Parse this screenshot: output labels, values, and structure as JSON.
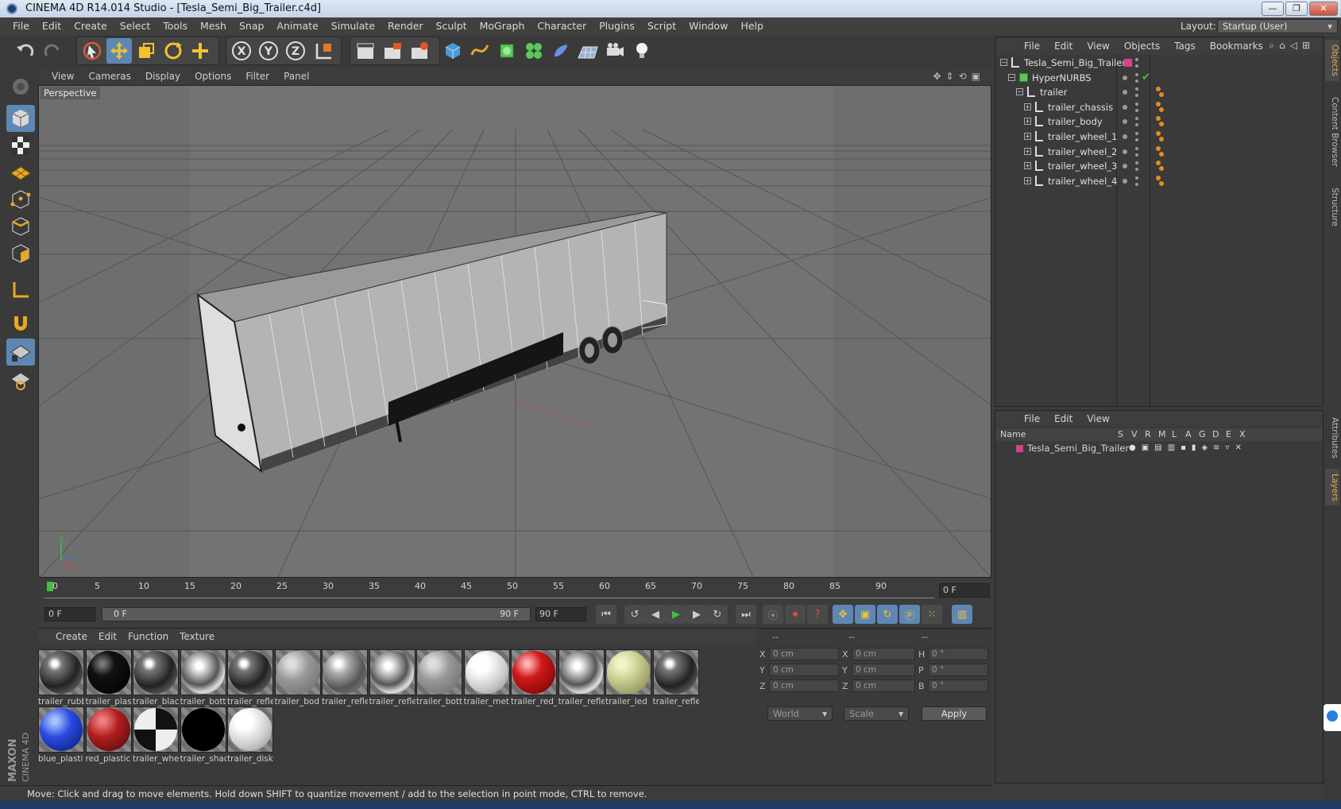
{
  "window": {
    "title": "CINEMA 4D R14.014 Studio - [Tesla_Semi_Big_Trailer.c4d]",
    "minimize": "—",
    "maximize": "❐",
    "close": "✕"
  },
  "menubar": {
    "items": [
      "File",
      "Edit",
      "Create",
      "Select",
      "Tools",
      "Mesh",
      "Snap",
      "Animate",
      "Simulate",
      "Render",
      "Sculpt",
      "MoGraph",
      "Character",
      "Plugins",
      "Script",
      "Window",
      "Help"
    ]
  },
  "layout": {
    "label": "Layout:",
    "value": "Startup (User)"
  },
  "viewport": {
    "menu": [
      "View",
      "Cameras",
      "Display",
      "Options",
      "Filter",
      "Panel"
    ],
    "label": "Perspective"
  },
  "timeline": {
    "ticks": [
      "0",
      "5",
      "10",
      "15",
      "20",
      "25",
      "30",
      "35",
      "40",
      "45",
      "50",
      "55",
      "60",
      "65",
      "70",
      "75",
      "80",
      "85",
      "90"
    ],
    "current_frame": "0 F"
  },
  "transport": {
    "start_field": "0 F",
    "range_start": "0 F",
    "range_end": "90 F",
    "end_field": "90 F"
  },
  "materials": {
    "menu": [
      "Create",
      "Edit",
      "Function",
      "Texture"
    ],
    "items": [
      {
        "name": "trailer_rubb",
        "style": "dark-metal"
      },
      {
        "name": "trailer_plas",
        "style": "black"
      },
      {
        "name": "trailer_blac",
        "style": "dark-metal"
      },
      {
        "name": "trailer_bott",
        "style": "chrome"
      },
      {
        "name": "trailer_refle",
        "style": "dark-metal"
      },
      {
        "name": "trailer_bod",
        "style": "grey"
      },
      {
        "name": "trailer_refle",
        "style": "grey-metal"
      },
      {
        "name": "trailer_refle",
        "style": "chrome"
      },
      {
        "name": "trailer_bott",
        "style": "grey"
      },
      {
        "name": "trailer_met",
        "style": "white"
      },
      {
        "name": "trailer_red_",
        "style": "red-glass"
      },
      {
        "name": "trailer_refle",
        "style": "chrome"
      },
      {
        "name": "trailer_led",
        "style": "olive"
      },
      {
        "name": "trailer_refle",
        "style": "dark-metal"
      },
      {
        "name": "blue_plasti",
        "style": "blue"
      },
      {
        "name": "red_plastic",
        "style": "red"
      },
      {
        "name": "trailer_whe",
        "style": "pattern"
      },
      {
        "name": "trailer_shac",
        "style": "pure-black"
      },
      {
        "name": "trailer_disk",
        "style": "white"
      }
    ]
  },
  "coords": {
    "header": [
      "--",
      "--",
      "--"
    ],
    "rows": [
      {
        "a": "X",
        "av": "0 cm",
        "b": "X",
        "bv": "0 cm",
        "c": "H",
        "cv": "0 °"
      },
      {
        "a": "Y",
        "av": "0 cm",
        "b": "Y",
        "bv": "0 cm",
        "c": "P",
        "cv": "0 °"
      },
      {
        "a": "Z",
        "av": "0 cm",
        "b": "Z",
        "bv": "0 cm",
        "c": "B",
        "cv": "0 °"
      }
    ],
    "mode1": "World",
    "mode2": "Scale",
    "apply": "Apply"
  },
  "objects": {
    "menu": [
      "File",
      "Edit",
      "View",
      "Objects",
      "Tags",
      "Bookmarks"
    ],
    "tree": [
      {
        "name": "Tesla_Semi_Big_Trailer",
        "depth": 0,
        "kind": "null"
      },
      {
        "name": "HyperNURBS",
        "depth": 1,
        "kind": "nurbs"
      },
      {
        "name": "trailer",
        "depth": 2,
        "kind": "null"
      },
      {
        "name": "trailer_chassis",
        "depth": 3,
        "kind": "null"
      },
      {
        "name": "trailer_body",
        "depth": 3,
        "kind": "null"
      },
      {
        "name": "trailer_wheel_1",
        "depth": 3,
        "kind": "null"
      },
      {
        "name": "trailer_wheel_2",
        "depth": 3,
        "kind": "null"
      },
      {
        "name": "trailer_wheel_3",
        "depth": 3,
        "kind": "null"
      },
      {
        "name": "trailer_wheel_4",
        "depth": 3,
        "kind": "null"
      }
    ]
  },
  "layers": {
    "menu": [
      "File",
      "Edit",
      "View"
    ],
    "columns": [
      "Name",
      "S",
      "V",
      "R",
      "M",
      "L",
      "A",
      "G",
      "D",
      "E",
      "X"
    ],
    "rows": [
      {
        "name": "Tesla_Semi_Big_Trailer",
        "color": "#d8408a"
      }
    ]
  },
  "right_tabs": [
    "Objects",
    "Content Browser",
    "Structure",
    "Attributes",
    "Layers"
  ],
  "status": "Move: Click and drag to move elements. Hold down SHIFT to quantize movement / add to the selection in point mode, CTRL to remove.",
  "branding": {
    "line1": "MAXON",
    "line2": "CINEMA 4D"
  },
  "colors": {
    "accent": "#5e87b4",
    "layer_tag": "#d8408a",
    "play": "#3fc23f"
  }
}
